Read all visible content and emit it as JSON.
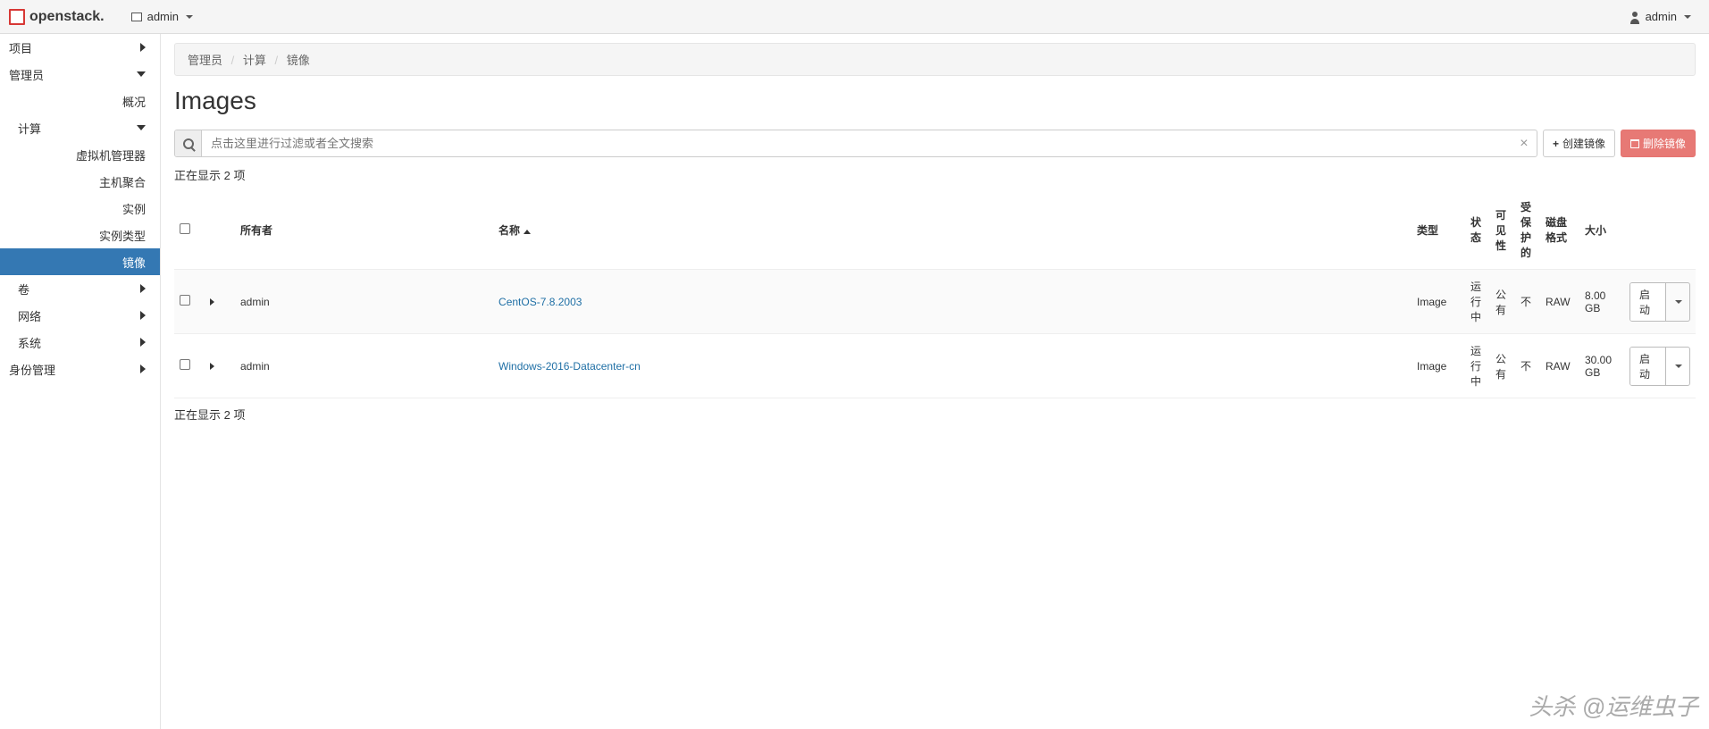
{
  "topbar": {
    "brand": "openstack.",
    "project_label": "admin",
    "user_label": "admin"
  },
  "sidebar": {
    "project": "项目",
    "admin": "管理员",
    "overview": "概况",
    "compute": "计算",
    "hypervisors": "虚拟机管理器",
    "host_agg": "主机聚合",
    "instances": "实例",
    "flavors": "实例类型",
    "images": "镜像",
    "volume": "卷",
    "network": "网络",
    "system": "系统",
    "identity": "身份管理"
  },
  "breadcrumb": {
    "a": "管理员",
    "b": "计算",
    "c": "镜像"
  },
  "page": {
    "title": "Images"
  },
  "toolbar": {
    "search_placeholder": "点击这里进行过滤或者全文搜索",
    "create": "创建镜像",
    "delete": "删除镜像"
  },
  "table": {
    "showing": "正在显示 2 项",
    "cols": {
      "owner": "所有者",
      "name": "名称",
      "type": "类型",
      "status": "状态",
      "visibility": "可见性",
      "protected": "受保护的",
      "disk_fmt": "磁盘格式",
      "size": "大小"
    },
    "rows": [
      {
        "owner": "admin",
        "name": "CentOS-7.8.2003",
        "type": "Image",
        "status": "运行中",
        "visibility": "公有",
        "protected": "不",
        "disk_fmt": "RAW",
        "size": "8.00 GB",
        "action": "启动"
      },
      {
        "owner": "admin",
        "name": "Windows-2016-Datacenter-cn",
        "type": "Image",
        "status": "运行中",
        "visibility": "公有",
        "protected": "不",
        "disk_fmt": "RAW",
        "size": "30.00 GB",
        "action": "启动"
      }
    ]
  },
  "watermark": "头杀 @运维虫子"
}
